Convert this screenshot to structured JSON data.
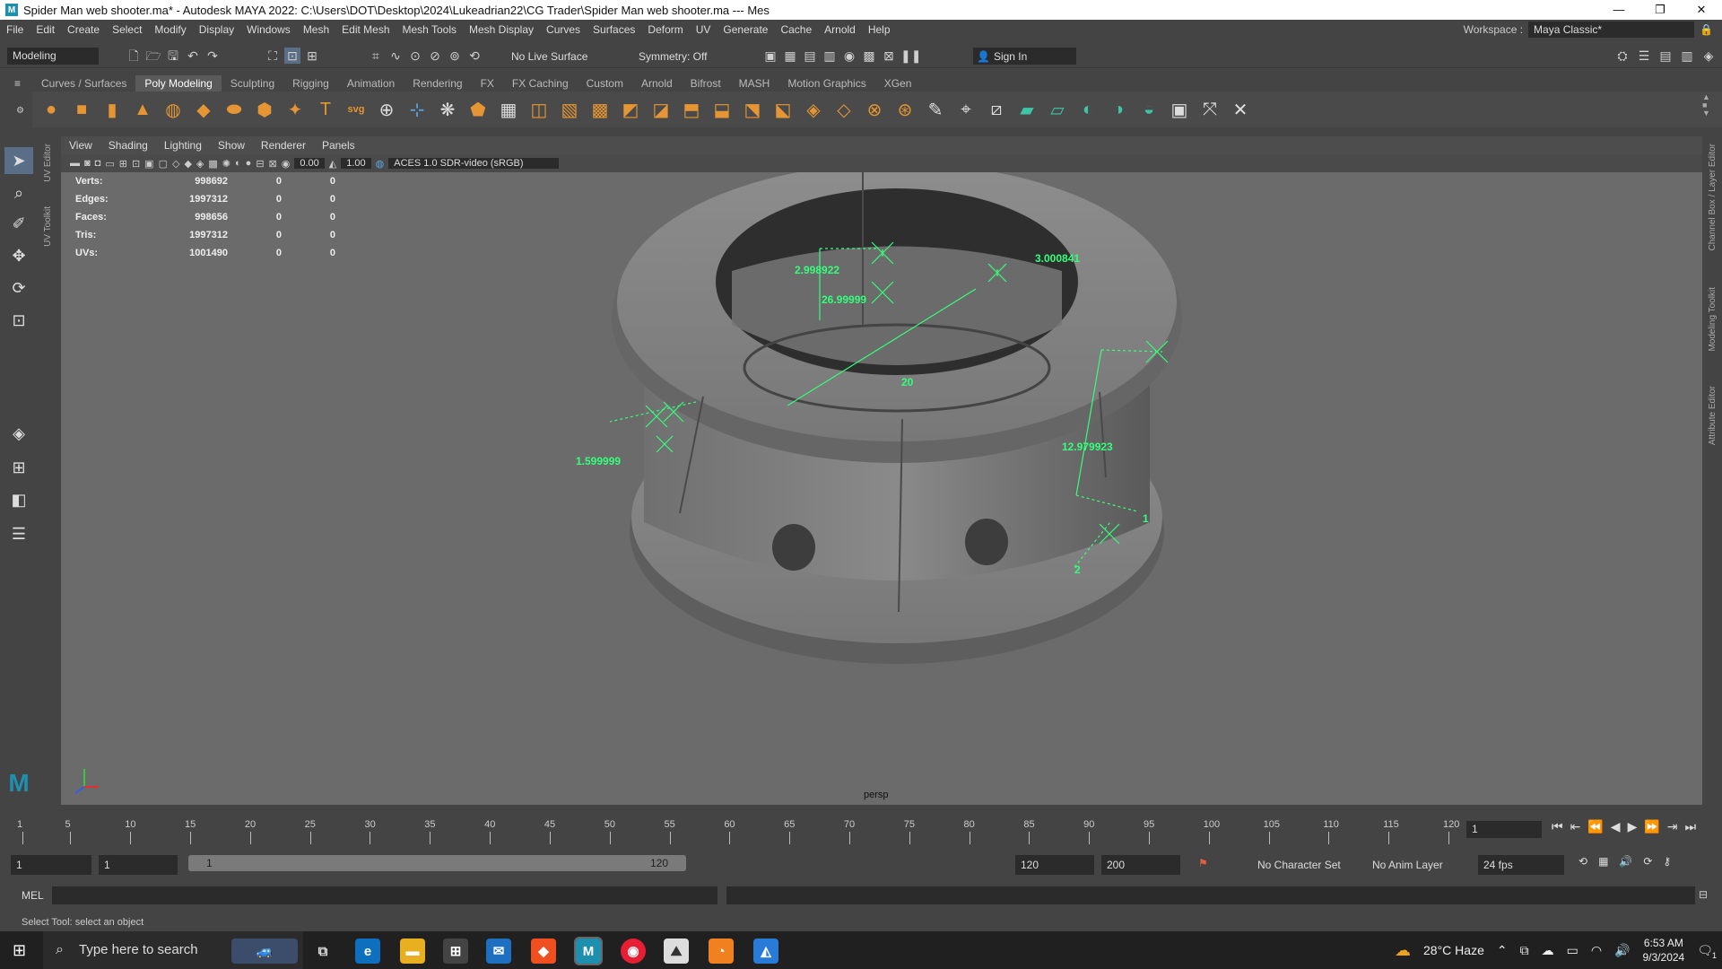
{
  "window": {
    "title": "Spider Man web shooter.ma* - Autodesk MAYA 2022: C:\\Users\\DOT\\Desktop\\2024\\Lukeadrian22\\CG Trader\\Spider Man web shooter.ma  ---  Mes",
    "minimize": "—",
    "restore": "❐",
    "close": "✕"
  },
  "menu": [
    "File",
    "Edit",
    "Create",
    "Select",
    "Modify",
    "Display",
    "Windows",
    "Mesh",
    "Edit Mesh",
    "Mesh Tools",
    "Mesh Display",
    "Curves",
    "Surfaces",
    "Deform",
    "UV",
    "Generate",
    "Cache",
    "Arnold",
    "Help"
  ],
  "workspace": {
    "label": "Workspace :",
    "value": "Maya Classic*"
  },
  "statusline": {
    "mode": "Modeling",
    "live_surface": "No Live Surface",
    "symmetry": "Symmetry: Off",
    "sign_in": "Sign In"
  },
  "shelf_tabs": [
    "Curves / Surfaces",
    "Poly Modeling",
    "Sculpting",
    "Rigging",
    "Animation",
    "Rendering",
    "FX",
    "FX Caching",
    "Custom",
    "Arnold",
    "Bifrost",
    "MASH",
    "Motion Graphics",
    "XGen"
  ],
  "shelf_active": "Poly Modeling",
  "side_tabs": {
    "left": [
      "UV Editor",
      "UV Toolkit"
    ],
    "right": [
      "Channel Box / Layer Editor",
      "Modeling Toolkit",
      "Attribute Editor"
    ]
  },
  "viewport": {
    "menu": [
      "View",
      "Shading",
      "Lighting",
      "Show",
      "Renderer",
      "Panels"
    ],
    "exposure": "0.00",
    "gamma": "1.00",
    "color_space": "ACES 1.0 SDR-video (sRGB)",
    "camera": "persp",
    "hud": [
      {
        "label": "Verts:",
        "a": "998692",
        "b": "0",
        "c": "0"
      },
      {
        "label": "Edges:",
        "a": "1997312",
        "b": "0",
        "c": "0"
      },
      {
        "label": "Faces:",
        "a": "998656",
        "b": "0",
        "c": "0"
      },
      {
        "label": "Tris:",
        "a": "1997312",
        "b": "0",
        "c": "0"
      },
      {
        "label": "UVs:",
        "a": "1001490",
        "b": "0",
        "c": "0"
      }
    ],
    "measurements": [
      "2.998922",
      "26.99999",
      "3.000841",
      "20",
      "12.979923",
      "1.599999",
      "1",
      "2"
    ]
  },
  "timeline": {
    "ticks": [
      "1",
      "5",
      "10",
      "15",
      "20",
      "25",
      "30",
      "35",
      "40",
      "45",
      "50",
      "55",
      "60",
      "65",
      "70",
      "75",
      "80",
      "85",
      "90",
      "95",
      "100",
      "105",
      "110",
      "115",
      "120"
    ],
    "current_frame": "1"
  },
  "range": {
    "start": "1",
    "anim_start": "1",
    "slider_start": "1",
    "slider_end": "120",
    "end": "120",
    "anim_end": "200",
    "character_set": "No Character Set",
    "anim_layer": "No Anim Layer",
    "fps": "24 fps"
  },
  "command": {
    "label": "MEL"
  },
  "help": "Select Tool: select an object",
  "taskbar": {
    "search_placeholder": "Type here to search",
    "weather": "28°C  Haze",
    "time": "6:53 AM",
    "date": "9/3/2024",
    "notif": "1"
  },
  "colors": {
    "measure": "#35ff7a",
    "accent_orange": "#e59533",
    "accent_green": "#3ec5a8",
    "selected_tool": "#5a6e88"
  }
}
